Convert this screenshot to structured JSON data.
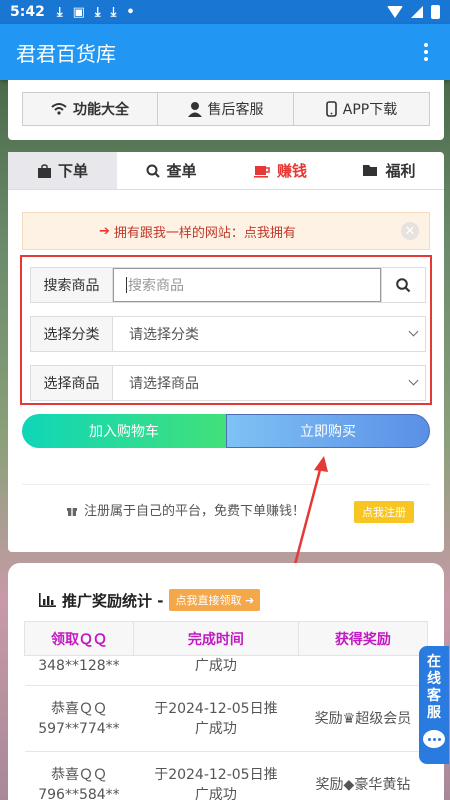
{
  "status_bar": {
    "time": "5:42",
    "dot": "•"
  },
  "app_bar": {
    "title": "君君百货库"
  },
  "top_buttons": [
    {
      "label": "功能大全",
      "icon": "wifi-icon"
    },
    {
      "label": "售后客服",
      "icon": "user-icon"
    },
    {
      "label": "APP下载",
      "icon": "phone-icon"
    }
  ],
  "tabs": [
    {
      "label": "下单",
      "icon": "bag-icon"
    },
    {
      "label": "查单",
      "icon": "search-icon"
    },
    {
      "label": "赚钱",
      "icon": "cup-icon"
    },
    {
      "label": "福利",
      "icon": "folder-icon"
    }
  ],
  "notice": {
    "text": "拥有跟我一样的网站：点我拥有"
  },
  "form": {
    "search_label": "搜索商品",
    "search_placeholder": "搜索商品",
    "category_label": "选择分类",
    "category_value": "请选择分类",
    "product_label": "选择商品",
    "product_value": "请选择商品"
  },
  "actions": {
    "cart": "加入购物车",
    "buy": "立即购买"
  },
  "register": {
    "text": "注册属于自己的平台，免费下单赚钱！",
    "button": "点我注册"
  },
  "stats": {
    "title": "推广奖励统计 -",
    "claim": "点我直接领取",
    "headers": [
      "领取ＱＱ",
      "完成时间",
      "获得奖励"
    ],
    "rows": [
      {
        "qq": "348**128**",
        "time": "广成功",
        "reward": ""
      },
      {
        "qq_line1": "恭喜ＱＱ",
        "qq_line2": "597**774**",
        "time_line1": "于2024-12-05日推",
        "time_line2": "广成功",
        "reward": "奖励",
        "reward_item": "超级会员"
      },
      {
        "qq_line1": "恭喜ＱＱ",
        "qq_line2": "796**584**",
        "time_line1": "于2024-12-05日推",
        "time_line2": "广成功",
        "reward": "奖励",
        "reward_item": "豪华黄钻"
      }
    ]
  },
  "service": {
    "label": [
      "在",
      "线",
      "客",
      "服"
    ]
  },
  "colors": {
    "primary": "#2196f3",
    "accent_red": "#e53935",
    "header_purple": "#c21ac2"
  }
}
